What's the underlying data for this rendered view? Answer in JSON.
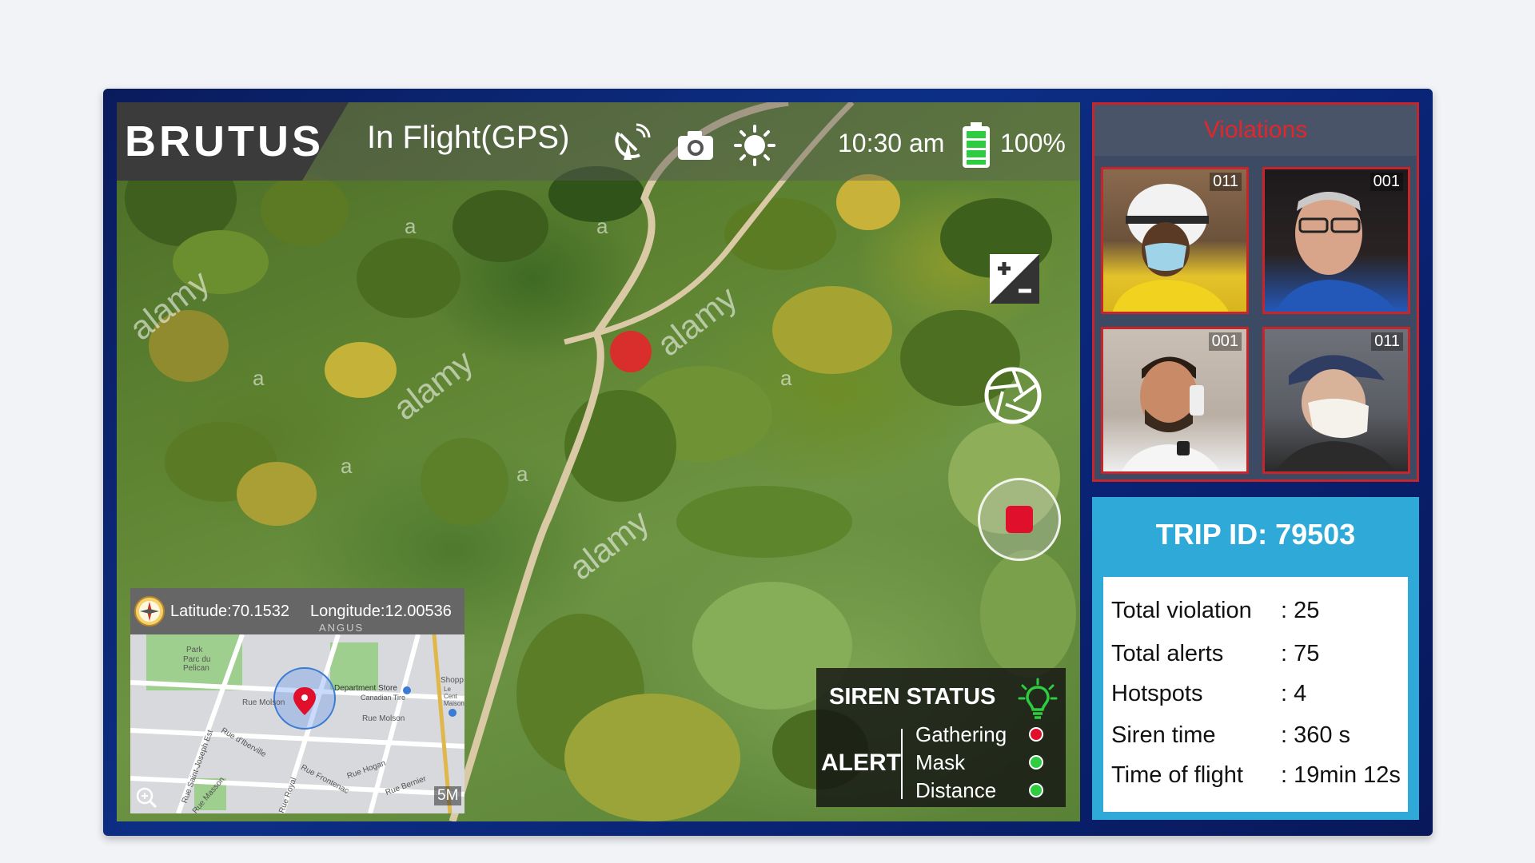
{
  "header": {
    "brand": "BRUTUS",
    "flight_mode": "In Flight(GPS)",
    "time": "10:30 am",
    "battery_pct": "100%",
    "battery_level": 1.0,
    "icons": [
      "satellite-dish-icon",
      "camera-icon",
      "brightness-icon",
      "battery-icon"
    ]
  },
  "camera": {
    "watermark": "alamy",
    "watermark_small": "a",
    "controls": [
      "exposure-icon",
      "aperture-icon",
      "record-button"
    ]
  },
  "map": {
    "latitude": "Latitude:70.1532",
    "longitude": "Longitude:12.00536",
    "scale": "5M",
    "labels": {
      "angus": "ANGUS",
      "park": "Park",
      "parc": "Parc du Pelican",
      "dept_store": "Department Store",
      "canadian_tire": "Canadian Tire",
      "shop": "Shopp",
      "le_cent": "Le Cent Maison",
      "molson": "Rue Molson",
      "iberville": "Rue d'Iberville",
      "frontenac": "Rue Frontenac",
      "st_joseph": "Rue Saint-Joseph Est",
      "hogan": "Rue Hogan",
      "bernier": "Rue Bernier",
      "royal": "Rue Royal",
      "masson": "Rue Masson"
    }
  },
  "siren": {
    "title": "SIREN STATUS",
    "alert_label": "ALERT",
    "rows": [
      {
        "label": "Gathering",
        "status_color": "#e0102c"
      },
      {
        "label": "Mask",
        "status_color": "#2ecc40"
      },
      {
        "label": "Distance",
        "status_color": "#2ecc40"
      }
    ],
    "bulb_color": "#2ecc40"
  },
  "violations": {
    "title": "Violations",
    "faces": [
      {
        "id": "011"
      },
      {
        "id": "001"
      },
      {
        "id": "001"
      },
      {
        "id": "011"
      }
    ]
  },
  "trip": {
    "title": "TRIP ID: 79503",
    "stats": [
      {
        "label": "Total violation",
        "value": ": 25"
      },
      {
        "label": "Total alerts",
        "value": ": 75"
      },
      {
        "label": "Hotspots",
        "value": ": 4"
      },
      {
        "label": "Siren time",
        "value": ": 360 s"
      },
      {
        "label": "Time of flight",
        "value": ": 19min 12s"
      }
    ]
  },
  "colors": {
    "accent_red": "#e3262b",
    "trip_blue": "#2ea9d8",
    "frame_navy": "#0c2f86"
  }
}
